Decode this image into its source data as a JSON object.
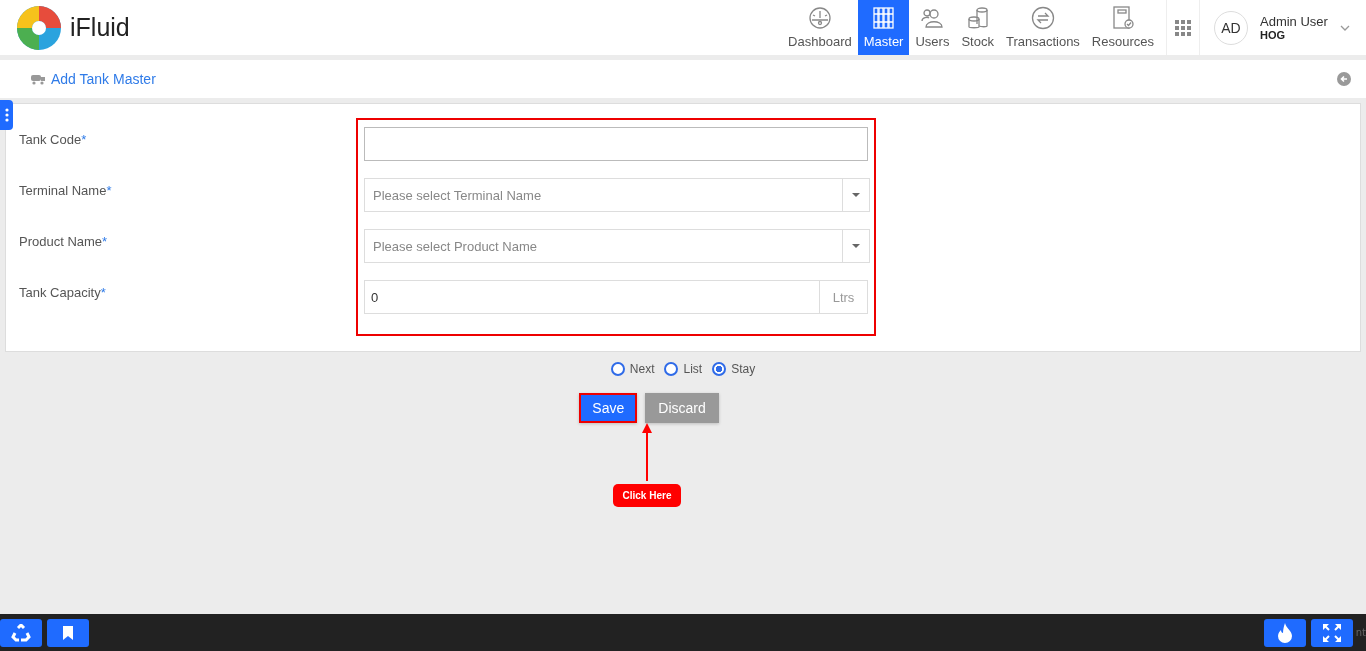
{
  "brand": {
    "name": "iFluid"
  },
  "nav": [
    {
      "label": "Dashboard",
      "selected": false
    },
    {
      "label": "Master",
      "selected": true
    },
    {
      "label": "Users",
      "selected": false
    },
    {
      "label": "Stock",
      "selected": false
    },
    {
      "label": "Transactions",
      "selected": false
    },
    {
      "label": "Resources",
      "selected": false
    }
  ],
  "user": {
    "initials": "AD",
    "name": "Admin User",
    "org": "HOG"
  },
  "page_title": "Add Tank Master",
  "form": {
    "fields": [
      {
        "kind": "text",
        "label": "Tank Code",
        "required_mark": "*"
      },
      {
        "kind": "select",
        "label": "Terminal Name",
        "required_mark": "*",
        "placeholder": "Please select Terminal Name"
      },
      {
        "kind": "select",
        "label": "Product Name",
        "required_mark": "*",
        "placeholder": "Please select Product Name"
      },
      {
        "kind": "unit",
        "label": "Tank Capacity",
        "required_mark": "*",
        "value": "0",
        "unit": "Ltrs"
      }
    ]
  },
  "after_save": [
    {
      "label": "Next",
      "selected": false
    },
    {
      "label": "List",
      "selected": false
    },
    {
      "label": "Stay",
      "selected": true
    }
  ],
  "buttons": [
    {
      "kind": "primary",
      "label": "Save"
    },
    {
      "kind": "secondary",
      "label": "Discard"
    }
  ],
  "callout": "Click Here",
  "footer_text": "nt"
}
